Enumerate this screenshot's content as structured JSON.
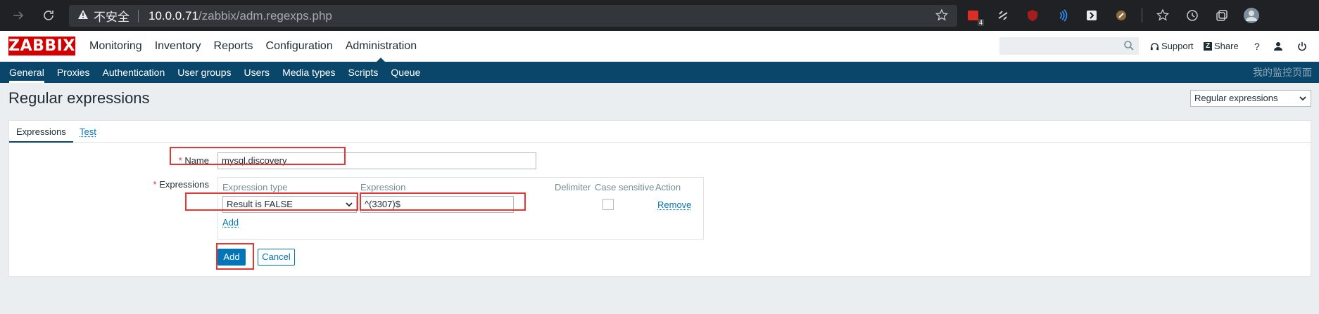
{
  "browser": {
    "insecure_label": "不安全",
    "url_host": "10.0.0.71",
    "url_path": "/zabbix/adm.regexps.php",
    "extension_badge": "4"
  },
  "topnav": {
    "logo": "ZABBIX",
    "menu": [
      "Monitoring",
      "Inventory",
      "Reports",
      "Configuration",
      "Administration"
    ],
    "active_menu": "Administration",
    "search_placeholder": "",
    "support": "Support",
    "share": "Share",
    "help": "?"
  },
  "subnav": {
    "items": [
      "General",
      "Proxies",
      "Authentication",
      "User groups",
      "Users",
      "Media types",
      "Scripts",
      "Queue"
    ],
    "active": "General",
    "right_text": "我的监控页面"
  },
  "page": {
    "title": "Regular expressions",
    "view_select": "Regular expressions"
  },
  "form": {
    "tabs": [
      "Expressions",
      "Test"
    ],
    "active_tab": "Expressions",
    "name_label": "Name",
    "name_value": "mysql.discovery",
    "expressions_label": "Expressions",
    "required_mark": "*",
    "columns": [
      "Expression type",
      "Expression",
      "Delimiter",
      "Case sensitive",
      "Action"
    ],
    "row": {
      "expression_type": "Result is FALSE",
      "expression": "^(3307)$",
      "delimiter": "",
      "case_sensitive": false,
      "action": "Remove"
    },
    "add_link": "Add",
    "add_button": "Add",
    "cancel_button": "Cancel"
  },
  "colors": {
    "zabbix_red": "#d40000",
    "nav_blue": "#0a466a",
    "link_blue": "#0275b8",
    "highlight_red": "#e33734"
  }
}
